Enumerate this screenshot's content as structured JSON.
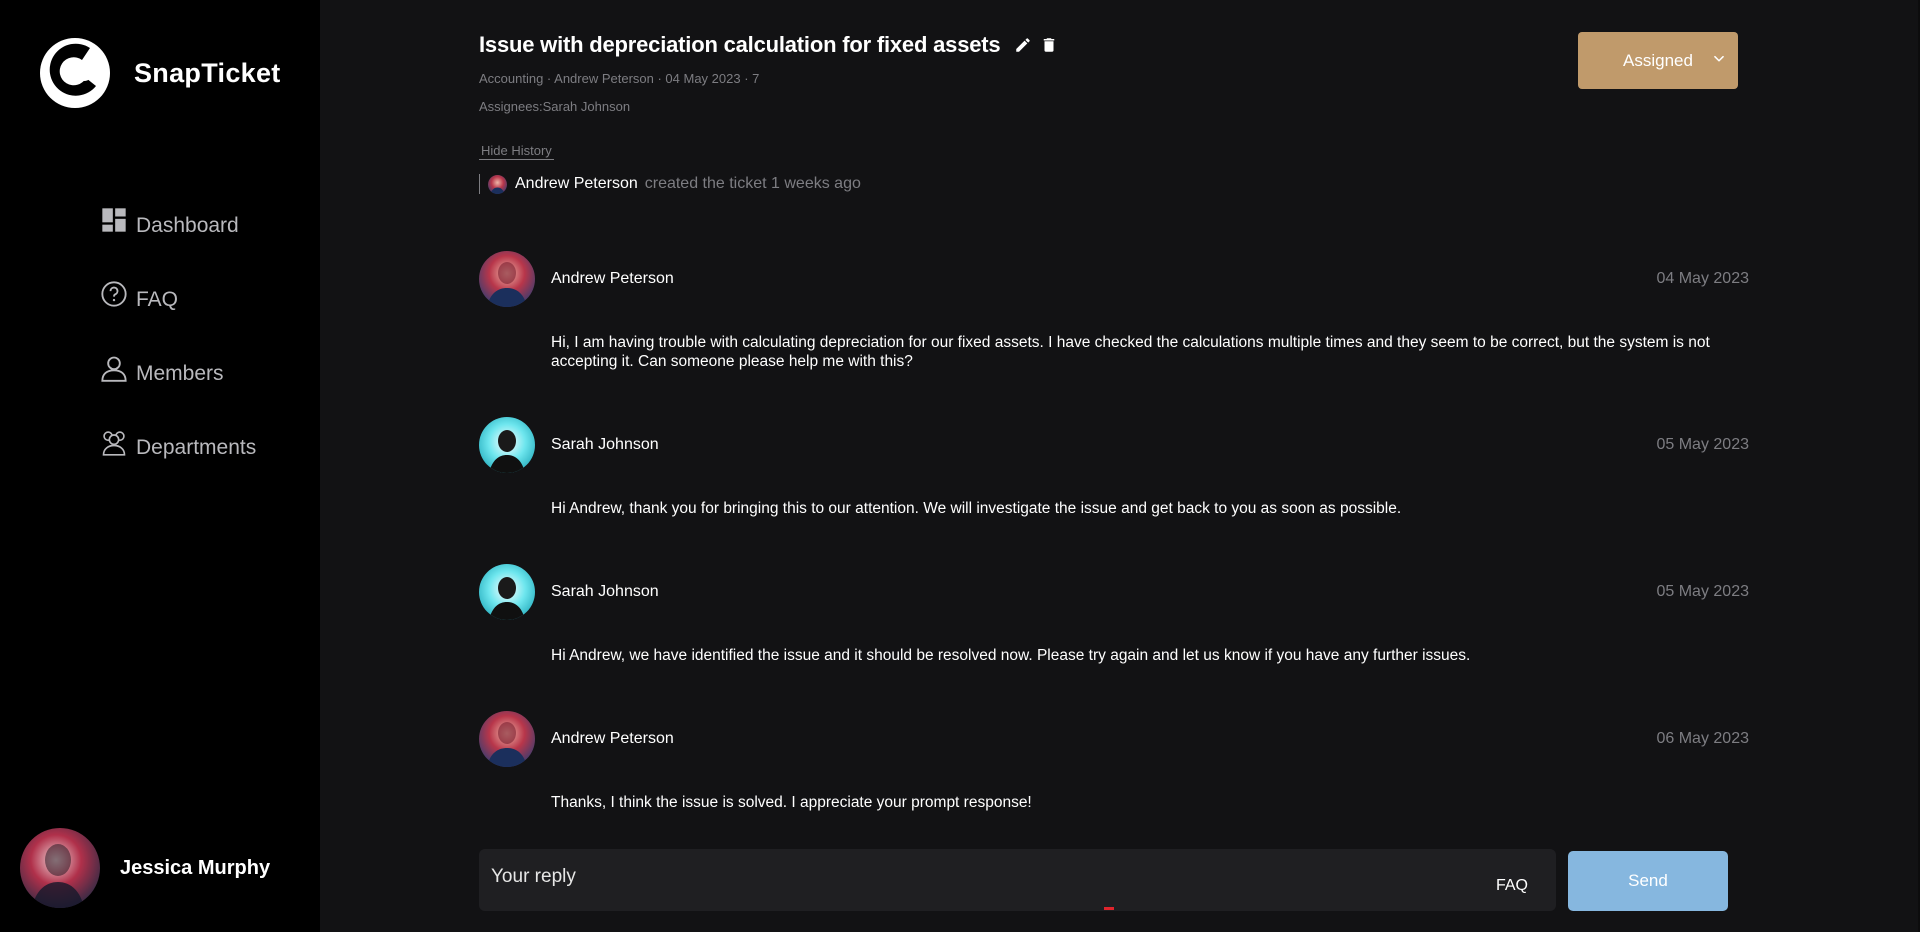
{
  "app": {
    "name": "SnapTicket"
  },
  "sidebar": {
    "items": [
      {
        "label": "Dashboard",
        "icon": "dashboard-icon"
      },
      {
        "label": "FAQ",
        "icon": "help-circle-icon"
      },
      {
        "label": "Members",
        "icon": "person-icon"
      },
      {
        "label": "Departments",
        "icon": "group-icon"
      }
    ],
    "user": {
      "name": "Jessica Murphy"
    }
  },
  "ticket": {
    "title": "Issue with depreciation calculation for fixed assets",
    "meta": "Accounting · Andrew Peterson · 04 May 2023 · 7",
    "assignees": "Assignees:Sarah Johnson",
    "status": "Assigned",
    "status_color": "#c09a6b"
  },
  "history": {
    "toggle_label": "Hide History",
    "entries": [
      {
        "name": "Andrew Peterson",
        "action": "created the ticket 1 weeks ago"
      }
    ]
  },
  "messages": [
    {
      "author": "Andrew Peterson",
      "date": "04 May 2023",
      "body": "Hi, I am having trouble with calculating depreciation for our fixed assets. I have checked the calculations multiple times and they seem to be correct, but the system is not accepting it. Can someone please help me with this?"
    },
    {
      "author": "Sarah Johnson",
      "date": "05 May 2023",
      "body": "Hi Andrew, thank you for bringing this to our attention. We will investigate the issue and get back to you as soon as possible."
    },
    {
      "author": "Sarah Johnson",
      "date": "05 May 2023",
      "body": "Hi Andrew, we have identified the issue and it should be resolved now. Please try again and let us know if you have any further issues."
    },
    {
      "author": "Andrew Peterson",
      "date": "06 May 2023",
      "body": "Thanks, I think the issue is solved. I appreciate your prompt response!"
    }
  ],
  "reply": {
    "placeholder": "Your reply",
    "faq_label": "FAQ",
    "send_label": "Send",
    "send_color": "#86b7df"
  }
}
